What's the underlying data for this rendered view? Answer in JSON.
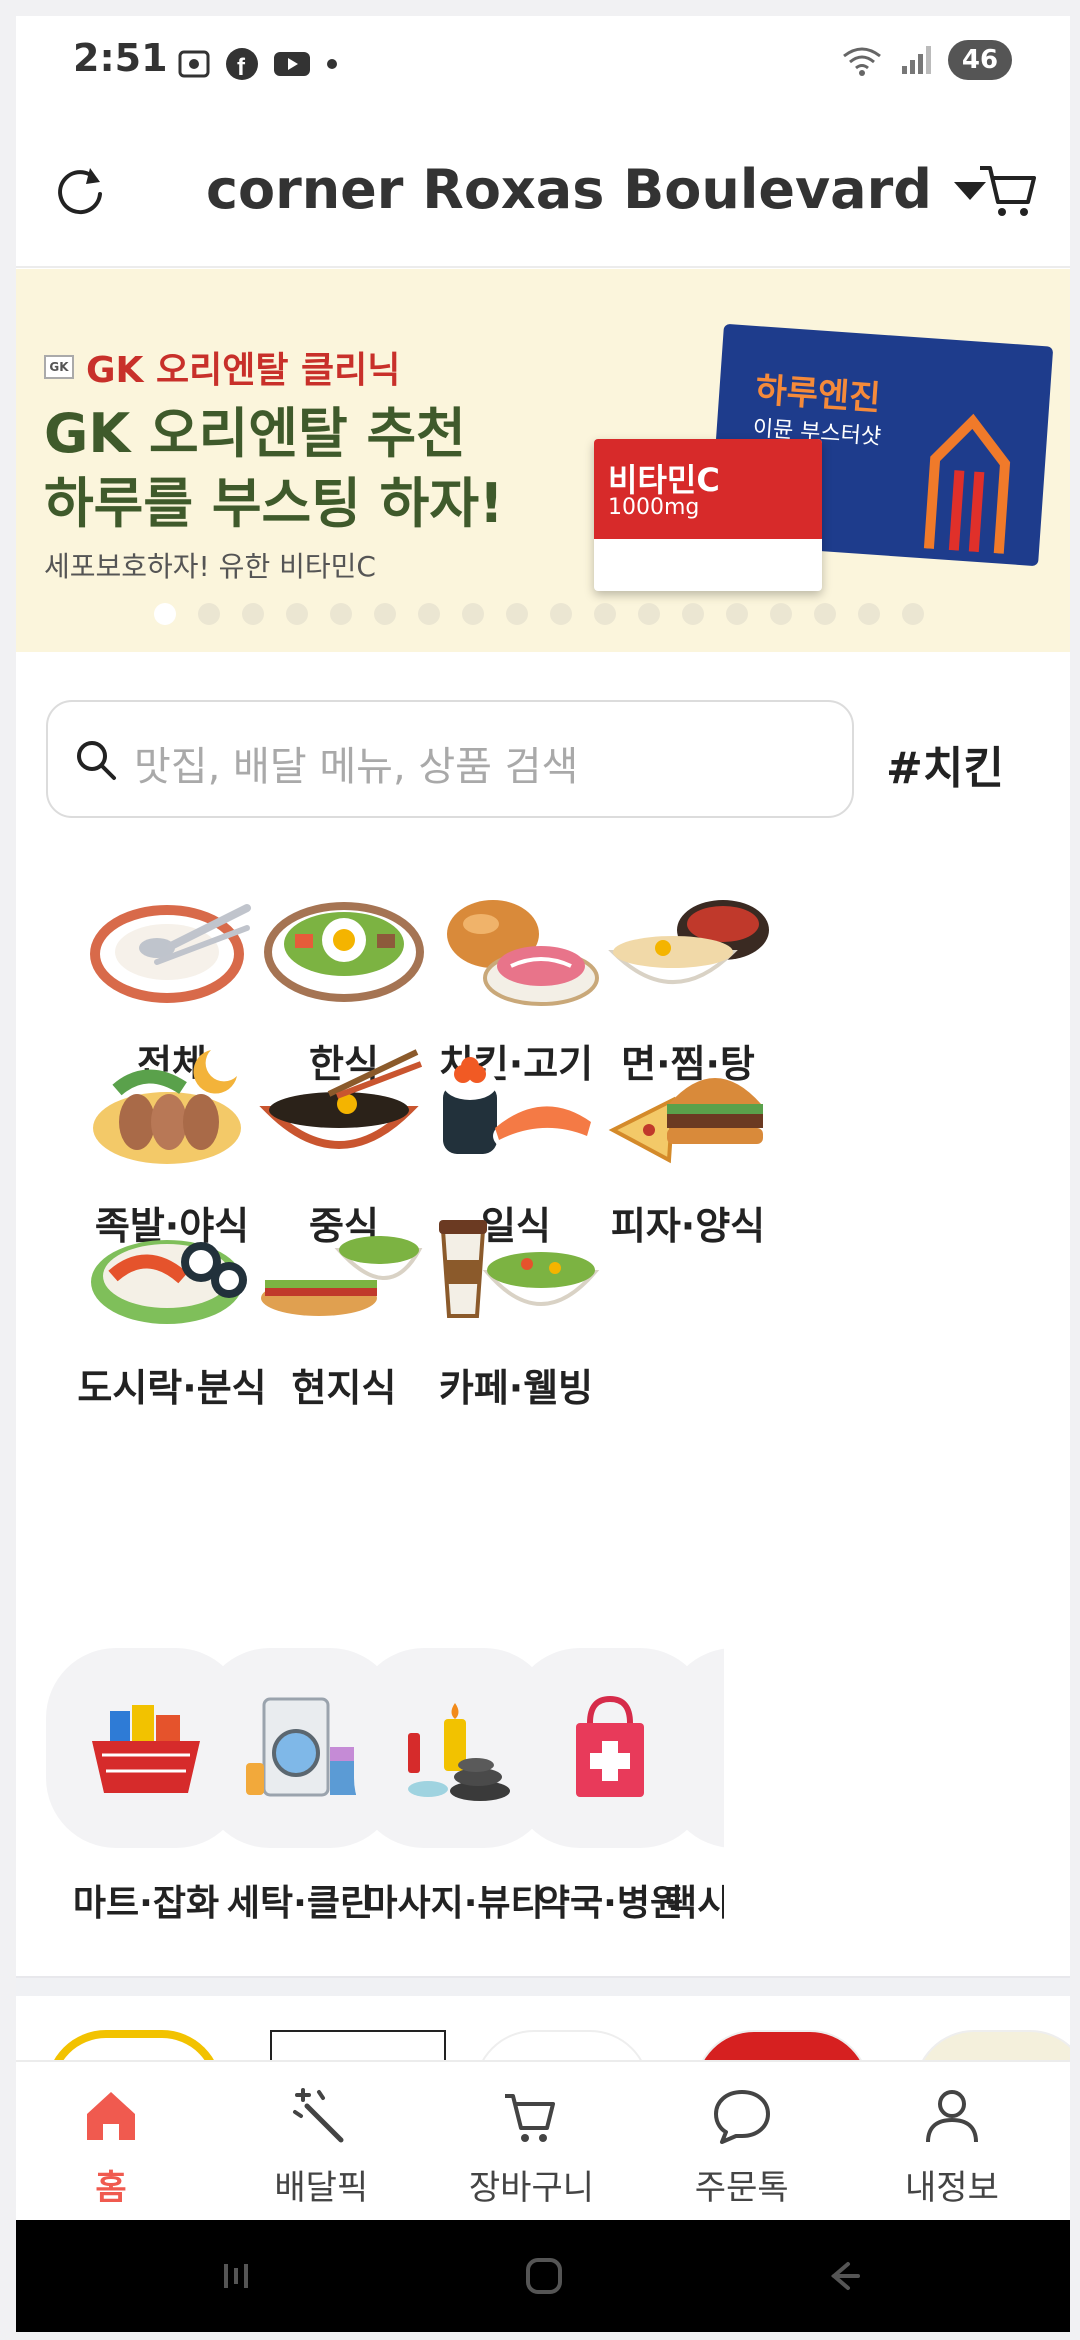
{
  "status_bar": {
    "time": "2:51",
    "battery": "46"
  },
  "header": {
    "location": "corner Roxas Boulevard"
  },
  "banner": {
    "brand": "GK 오리엔탈 클리닉",
    "brand_logo": "GK",
    "headline_line1": "GK 오리엔탈 추천",
    "headline_line2": "하루를 부스팅 하자!",
    "sub": "세포보호하자! 유한 비타민C",
    "product1_title": "하루엔진",
    "product1_sub": "이뮨 부스터샷",
    "product2_title": "비타민C",
    "product2_sub": "1000mg",
    "slide_count": 18,
    "active_slide": 1
  },
  "search": {
    "placeholder": "맛집, 배달 메뉴, 상품 검색",
    "hashtag": "#치킨"
  },
  "categories": [
    {
      "label": "전체",
      "icon": "plate-utensils-icon"
    },
    {
      "label": "한식",
      "icon": "bibimbap-icon"
    },
    {
      "label": "치킨·고기",
      "icon": "chicken-meat-icon"
    },
    {
      "label": "면·찜·탕",
      "icon": "soup-bowl-icon"
    },
    {
      "label": "족발·야식",
      "icon": "jokbal-icon"
    },
    {
      "label": "중식",
      "icon": "noodle-bowl-icon"
    },
    {
      "label": "일식",
      "icon": "sushi-icon"
    },
    {
      "label": "피자·양식",
      "icon": "pizza-burger-icon"
    },
    {
      "label": "도시락·분식",
      "icon": "tteokbokki-icon"
    },
    {
      "label": "현지식",
      "icon": "sandwich-bowl-icon"
    },
    {
      "label": "카페·웰빙",
      "icon": "coffee-salad-icon"
    }
  ],
  "services": [
    {
      "label": "마트·잡화",
      "icon": "shopping-basket-icon"
    },
    {
      "label": "세탁·클린",
      "icon": "washing-machine-icon"
    },
    {
      "label": "마사지·뷰티",
      "icon": "spa-icon"
    },
    {
      "label": "약국·병원",
      "icon": "pharmacy-bag-icon"
    },
    {
      "label": "택시",
      "icon": "taxi-icon"
    }
  ],
  "bottom_nav": [
    {
      "label": "홈",
      "icon": "home-icon",
      "active": true
    },
    {
      "label": "배달픽",
      "icon": "magic-wand-icon",
      "active": false
    },
    {
      "label": "장바구니",
      "icon": "cart-icon",
      "active": false
    },
    {
      "label": "주문톡",
      "icon": "chat-icon",
      "active": false
    },
    {
      "label": "내정보",
      "icon": "user-icon",
      "active": false
    }
  ],
  "colors": {
    "accent": "#f05a4f",
    "banner_bg": "#fbf5dc",
    "headline": "#3f5a2b",
    "brand_red": "#c8302a"
  }
}
